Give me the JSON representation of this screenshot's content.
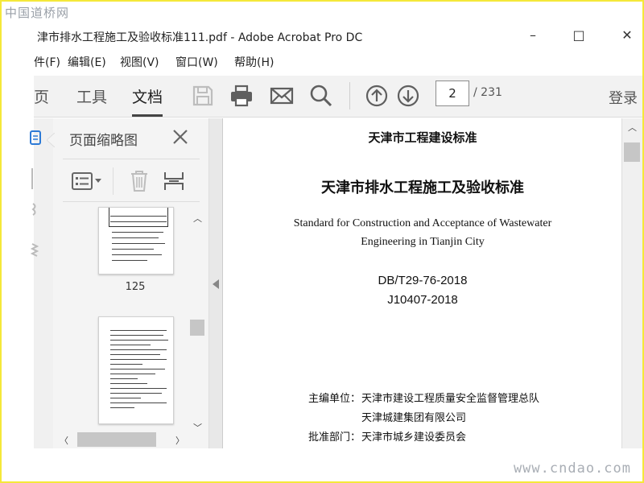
{
  "watermarks": {
    "top_left": "中国道桥网",
    "bottom_right": "www.cndao.com"
  },
  "window": {
    "title": "津市排水工程施工及验收标准111.pdf - Adobe Acrobat Pro DC",
    "minimize_glyph": "–",
    "maximize_glyph": "□",
    "close_glyph": "✕"
  },
  "menu": {
    "items": [
      "件(F)",
      "编辑(E)",
      "视图(V)",
      "窗口(W)",
      "帮助(H)"
    ]
  },
  "toolbar": {
    "tabs": [
      {
        "label": "页",
        "active": false
      },
      {
        "label": "工具",
        "active": false
      },
      {
        "label": "文档",
        "active": true
      }
    ],
    "icons": [
      "save-icon",
      "print-icon",
      "email-icon",
      "search-icon",
      "page-up-icon",
      "page-down-icon"
    ],
    "current_page": "2",
    "total_pages": "/ 231",
    "login_label": "登录",
    "colors": {
      "icon": "#5f5f5f",
      "icon_disabled": "#bdbdbd"
    }
  },
  "thumbnails_panel": {
    "title": "页面缩略图",
    "thumbnails": [
      {
        "label": "125"
      },
      {
        "label": ""
      }
    ]
  },
  "document": {
    "standard_series": "天津市工程建设标准",
    "title_cn": "天津市排水工程施工及验收标准",
    "title_en_line1": "Standard for Construction and Acceptance of Wastewater",
    "title_en_line2": "Engineering in Tianjin City",
    "code_db": "DB/T29-76-2018",
    "code_j": "J10407-2018",
    "editor_label": "主编单位：",
    "editor_org1": "天津市建设工程质量安全监督管理总队",
    "editor_org2": "天津城建集团有限公司",
    "approver_label": "批准部门：",
    "approver_org": "天津市城乡建设委员会"
  }
}
